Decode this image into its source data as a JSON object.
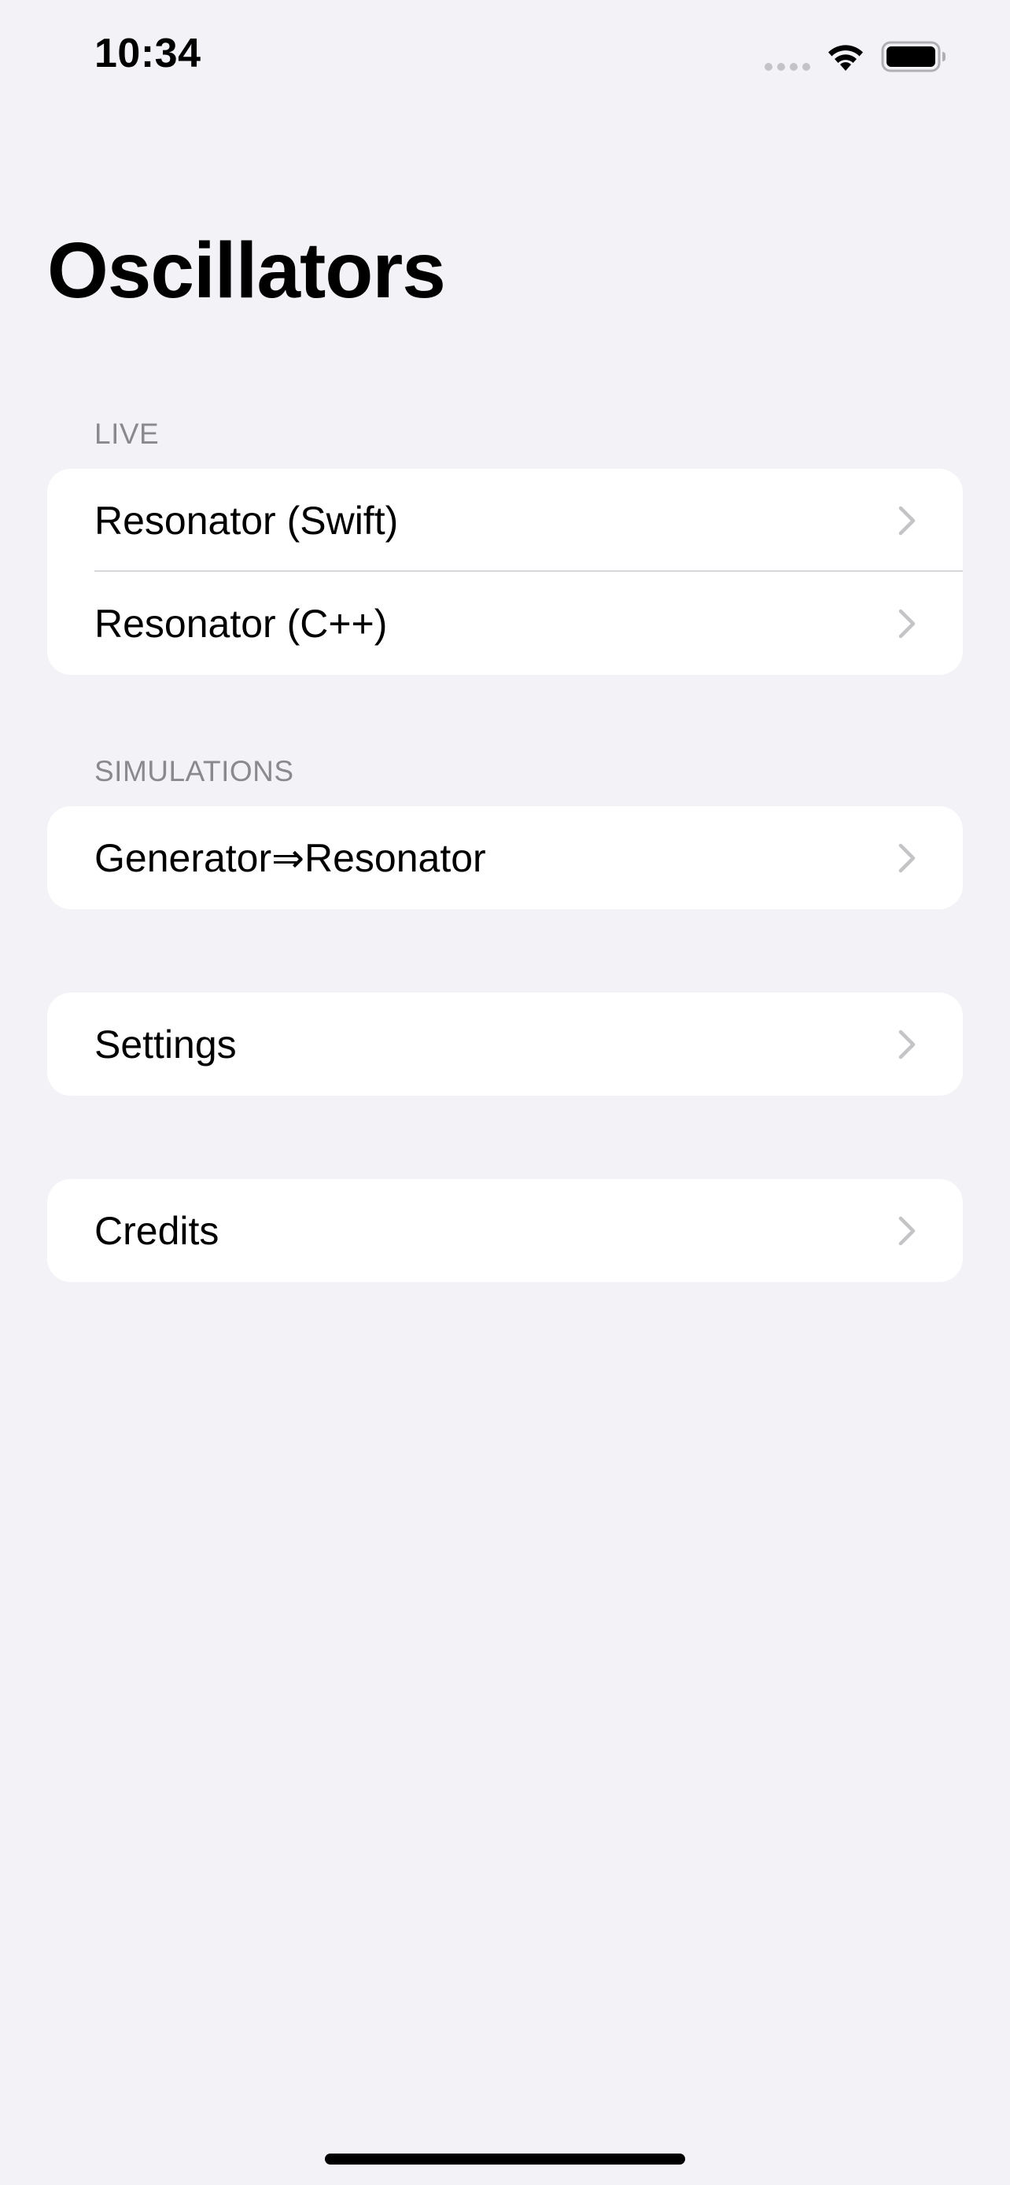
{
  "status_bar": {
    "time": "10:34",
    "icons": [
      "cellular-dots-icon",
      "wifi-icon",
      "battery-icon"
    ]
  },
  "nav": {
    "title": "Oscillators"
  },
  "sections": {
    "live": {
      "header": "LIVE",
      "items": [
        {
          "label": "Resonator (Swift)",
          "icon": "chevron-right-icon"
        },
        {
          "label": "Resonator (C++)",
          "icon": "chevron-right-icon"
        }
      ]
    },
    "simulations": {
      "header": "SIMULATIONS",
      "items": [
        {
          "label": "Generator⇒Resonator",
          "icon": "chevron-right-icon"
        }
      ]
    },
    "settings": {
      "items": [
        {
          "label": "Settings",
          "icon": "chevron-right-icon"
        }
      ]
    },
    "credits": {
      "items": [
        {
          "label": "Credits",
          "icon": "chevron-right-icon"
        }
      ]
    }
  },
  "colors": {
    "background": "#f2f2f7",
    "cell": "#ffffff",
    "section_header": "#8a8a8e",
    "chevron": "#c4c4c7",
    "separator": "#d6d6da"
  }
}
